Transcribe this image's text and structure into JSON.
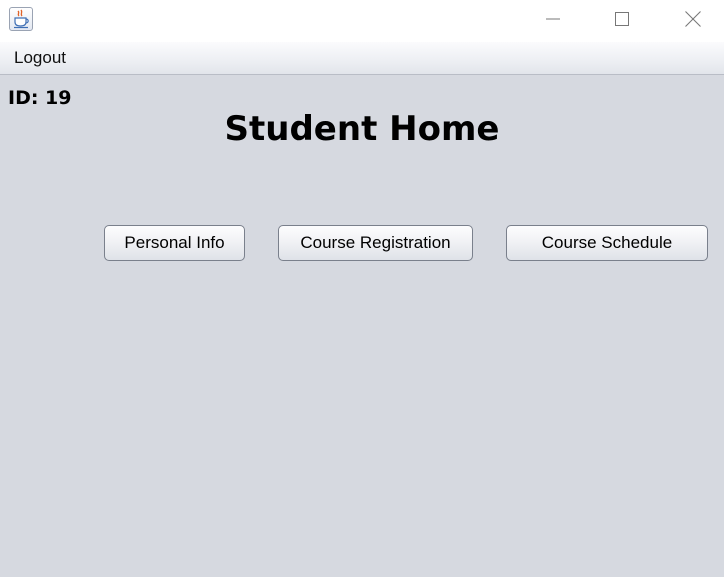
{
  "window": {
    "controls": {
      "minimize_icon": "minimize-icon",
      "maximize_icon": "maximize-icon",
      "close_icon": "close-icon"
    },
    "app_icon": "java-cup-icon"
  },
  "menubar": {
    "items": [
      {
        "label": "Logout"
      }
    ]
  },
  "content": {
    "student_id": "ID: 19",
    "title": "Student Home",
    "buttons": [
      {
        "label": "Personal Info"
      },
      {
        "label": "Course Registration"
      },
      {
        "label": "Course Schedule"
      }
    ]
  },
  "colors": {
    "background": "#d6d9e0",
    "titlebar": "#ffffff"
  }
}
